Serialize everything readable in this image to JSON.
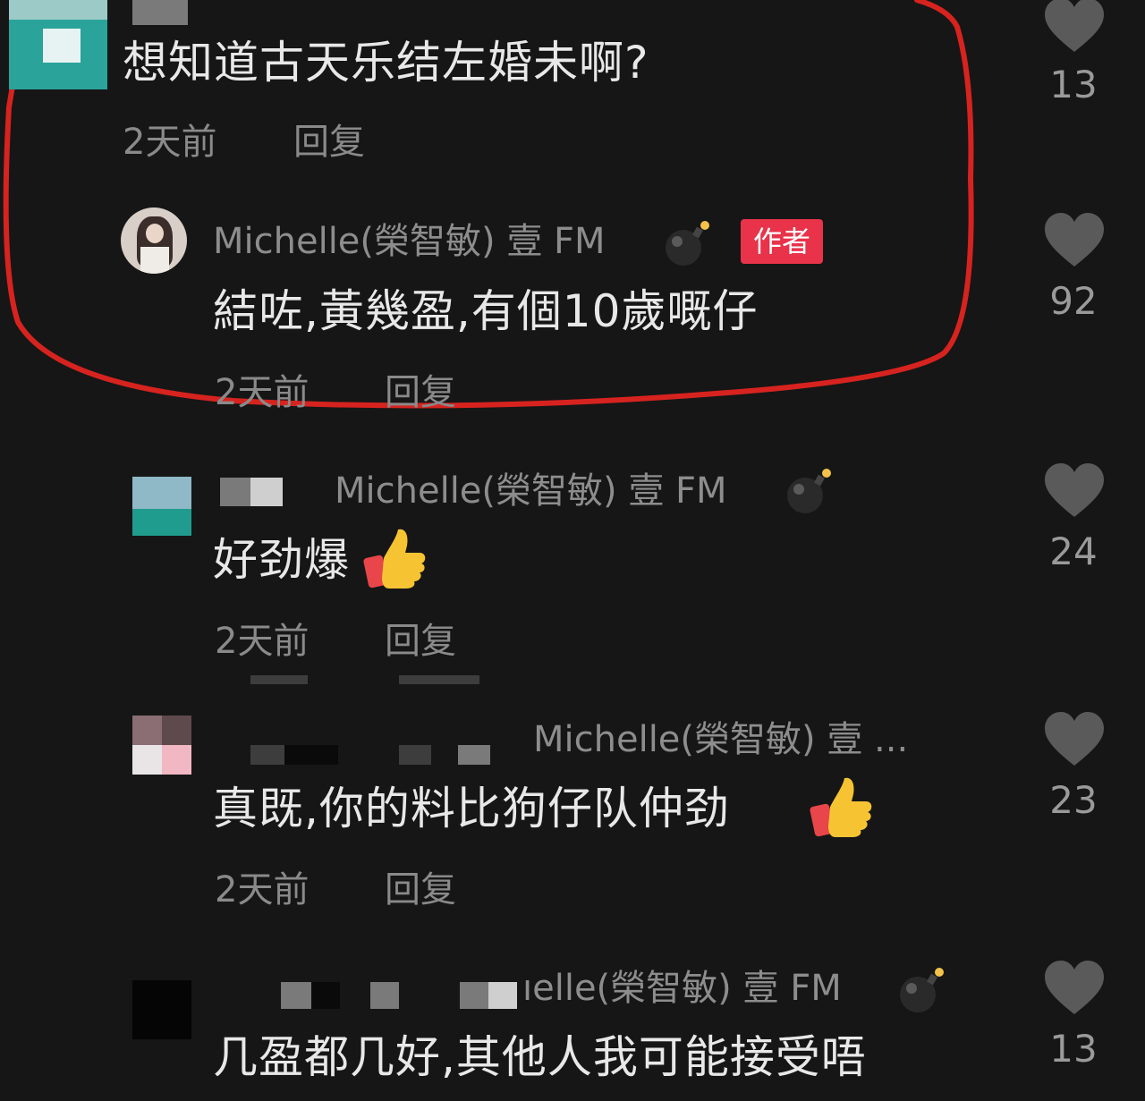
{
  "comments": [
    {
      "text": "想知道古天乐结左婚未啊?",
      "time": "2天前",
      "reply": "回复",
      "likes": "13"
    },
    {
      "username": "Michelle(榮智敏) 壹 FM",
      "badge": "作者",
      "text": "結咗,黃幾盈,有個10歲嘅仔",
      "time": "2天前",
      "reply": "回复",
      "likes": "92"
    },
    {
      "reply_to": "Michelle(榮智敏) 壹 FM",
      "text": "好劲爆",
      "time": "2天前",
      "reply": "回复",
      "likes": "24"
    },
    {
      "reply_to": "Michelle(榮智敏) 壹 ...",
      "text": "真既,你的料比狗仔队仲劲",
      "time": "2天前",
      "reply": "回复",
      "likes": "23"
    },
    {
      "reply_to": "ıelle(榮智敏) 壹 FM",
      "text": "几盈都几好,其他人我可能接受唔",
      "likes": "13"
    }
  ],
  "colors": {
    "background": "#161616",
    "highlight_outline": "#d7231f",
    "author_badge": "#e8334a",
    "heart": "#5a5a5a"
  },
  "icons": [
    "heart-icon",
    "bomb-emoji-icon",
    "thumbs-up-emoji-icon"
  ]
}
